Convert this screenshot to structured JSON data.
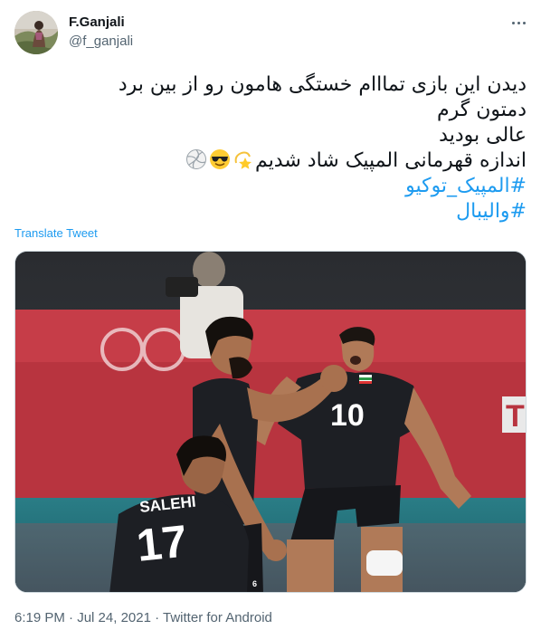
{
  "author": {
    "name": "F.Ganjali",
    "handle": "@f_ganjali"
  },
  "tweet": {
    "lines": [
      "دیدن این بازی تمااام خستگی هامون رو از بین برد",
      "دمتون گرم",
      "عالی بودید",
      "اندازه قهرمانی المپیک شاد شدیم"
    ],
    "emojis": [
      "volleyball-emoji",
      "sunglasses-emoji",
      "dizzy-star-emoji"
    ],
    "hashtags": [
      "#المپیک_توکیو",
      "#والیبال"
    ]
  },
  "translate_label": "Translate Tweet",
  "media": {
    "alt": "Iran volleyball players celebrating",
    "jersey_name": "SALEHI",
    "jersey_number_front": "17",
    "jersey_number_right": "10",
    "jersey_number_small": "6",
    "banner_letter": "T"
  },
  "meta": {
    "time": "6:19 PM",
    "separator": " · ",
    "date": "Jul 24, 2021",
    "source": "Twitter for Android"
  },
  "colors": {
    "link": "#1d9bf0",
    "secondary_text": "#536471",
    "arena_red": "#c8404a"
  }
}
